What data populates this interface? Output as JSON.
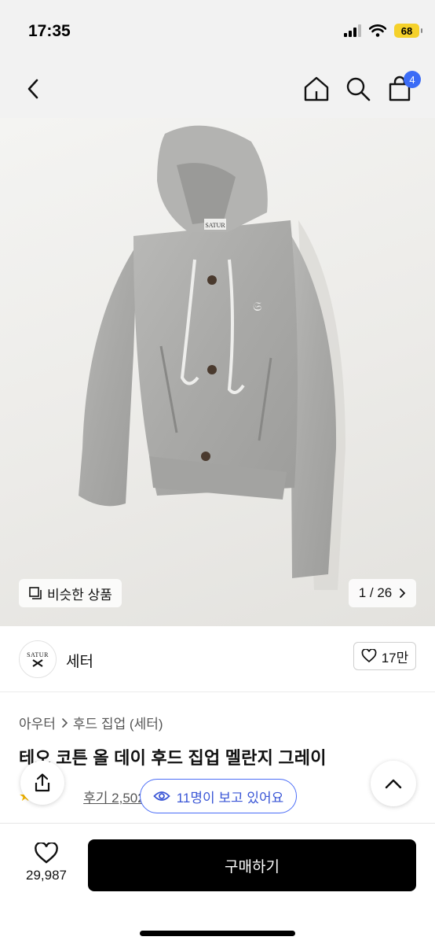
{
  "status_bar": {
    "time": "17:35",
    "battery": "68",
    "battery_color": "#f5d12b"
  },
  "nav": {
    "back_icon": "chevron-left-icon",
    "home_icon": "home-icon",
    "search_icon": "search-icon",
    "bag_icon": "shopping-bag-icon",
    "bag_badge": "4",
    "badge_color": "#3b6cf6"
  },
  "gallery": {
    "similar_label": "비슷한 상품",
    "pager": "1 / 26",
    "image_label": "SATUR"
  },
  "brand": {
    "logo_text": "SATUR",
    "name": "세터",
    "like_count": "17만"
  },
  "breadcrumb": {
    "items": [
      "아우터",
      "후드 집업 (세터)"
    ]
  },
  "product": {
    "title": "테오 코튼 올 데이 후드 집업 멜란지 그레이",
    "review_label": "후기 2,502"
  },
  "viewers": {
    "label": "11명이 보고 있어요",
    "accent": "#4a6cf7"
  },
  "bottom": {
    "wish_count": "29,987",
    "buy_label": "구매하기"
  }
}
